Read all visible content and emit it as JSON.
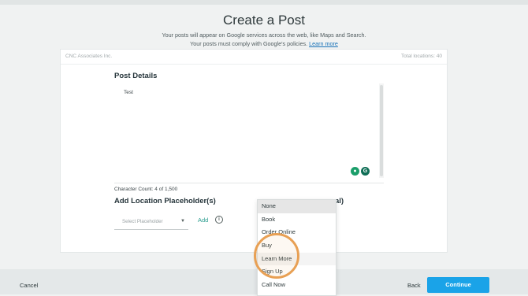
{
  "header": {
    "title": "Create a Post",
    "subtitle_line1": "Your posts will appear on Google services across the web, like Maps and Search.",
    "subtitle_line2": "Your posts must comply with Google's policies.",
    "learn_more_link": "Learn more"
  },
  "card": {
    "business_name": "CNC Associates Inc.",
    "total_locations": "Total locations: 40"
  },
  "post_details": {
    "title": "Post Details",
    "text_value": "Test",
    "char_count": "Character Count: 4 of 1,500"
  },
  "placeholders": {
    "title": "Add Location Placeholder(s)",
    "title_suffix": "al)",
    "select_placeholder": "Select Placeholder",
    "add_label": "Add",
    "info_glyph": "i"
  },
  "dropdown": {
    "items": [
      "None",
      "Book",
      "Order Online",
      "Buy",
      "Learn More",
      "Sign Up",
      "Call Now"
    ],
    "selected": "None",
    "hovered": "Learn More"
  },
  "footer": {
    "cancel_label": "Cancel",
    "back_label": "Back",
    "continue_label": "Continue"
  },
  "colors": {
    "accent": "#1aa3e8",
    "link": "#2a9d8f",
    "highlight_ring": "#e8a054"
  }
}
